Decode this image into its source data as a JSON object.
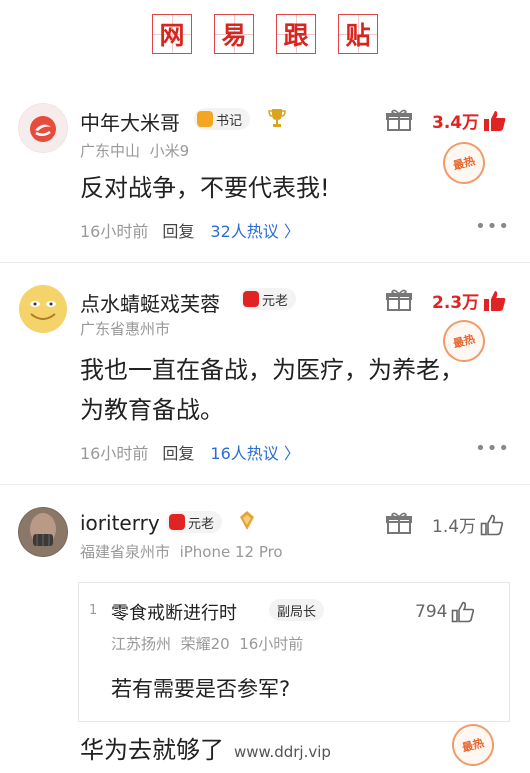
{
  "header": {
    "chars": [
      "网",
      "易",
      "跟",
      "贴"
    ]
  },
  "colors": {
    "accent_red": "#e02424",
    "link_blue": "#2a6cd6",
    "muted_gray": "#999999"
  },
  "comments": [
    {
      "username": "中年大米哥",
      "badge": "书记",
      "badge_icon": "gold-hexagon-icon",
      "extra_icon": "trophy-icon",
      "location": "广东中山",
      "device": "小米9",
      "text": "反对战争，不要代表我!",
      "time": "16小时前",
      "reply_label": "回复",
      "hot_label": "32人热议 〉",
      "likes": "3.4万",
      "stamp": "最热"
    },
    {
      "username": "点水蜻蜓戏芙蓉",
      "badge": "元老",
      "badge_icon": "red-shield-icon",
      "location": "广东省惠州市",
      "text_line1": "我也一直在备战，为医疗，为养老，",
      "text_line2": "为教育备战。",
      "time": "16小时前",
      "reply_label": "回复",
      "hot_label": "16人热议 〉",
      "likes": "2.3万",
      "stamp": "最热"
    },
    {
      "username": "ioriterry",
      "badge": "元老",
      "badge_icon": "red-shield-icon",
      "extra_icon": "medal-icon",
      "location": "福建省泉州市",
      "device": "iPhone 12 Pro",
      "likes": "1.4万",
      "nested_reply": {
        "index": "1",
        "username": "零食戒断进行时",
        "badge": "副局长",
        "location": "江苏扬州",
        "device": "荣耀20",
        "time": "16小时前",
        "text": "若有需要是否参军?",
        "likes": "794"
      },
      "text": "华为去就够了",
      "stamp": "最热"
    }
  ],
  "watermark": "www.ddrj.vip",
  "more_label": "•••"
}
